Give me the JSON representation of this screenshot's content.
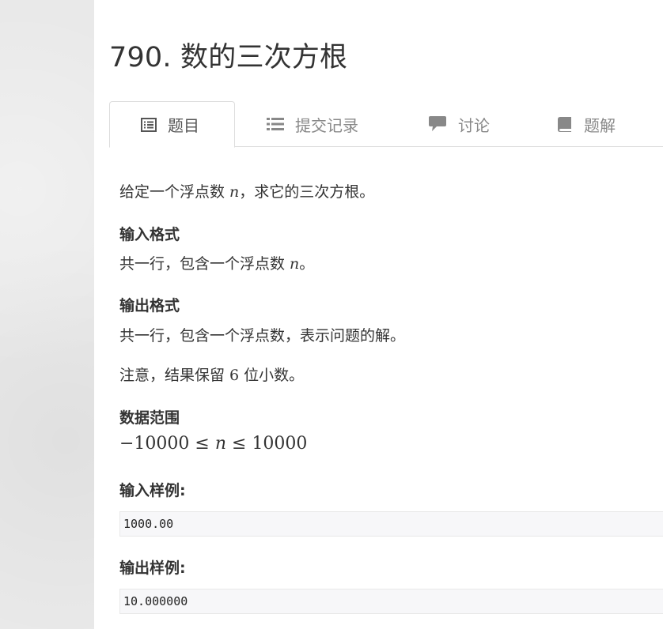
{
  "problem": {
    "title": "790. 数的三次方根"
  },
  "tabs": [
    {
      "label": "题目",
      "icon": "list-alt-icon",
      "active": true
    },
    {
      "label": "提交记录",
      "icon": "list-icon",
      "active": false
    },
    {
      "label": "讨论",
      "icon": "comment-icon",
      "active": false
    },
    {
      "label": "题解",
      "icon": "book-icon",
      "active": false
    }
  ],
  "description": {
    "text_before": "给定一个浮点数 ",
    "var": "n",
    "text_after": "，求它的三次方根。"
  },
  "input_format": {
    "heading": "输入格式",
    "text_before": "共一行，包含一个浮点数 ",
    "var": "n",
    "text_after": "。"
  },
  "output_format": {
    "heading": "输出格式",
    "text": "共一行，包含一个浮点数，表示问题的解。",
    "note_before": "注意，结果保留 ",
    "note_num": "6",
    "note_after": " 位小数。"
  },
  "data_range": {
    "heading": "数据范围",
    "low": "−10000",
    "le1": " ≤ ",
    "var": "n",
    "le2": " ≤ ",
    "high": "10000"
  },
  "sample_input": {
    "heading": "输入样例:",
    "code": "1000.00"
  },
  "sample_output": {
    "heading": "输出样例:",
    "code": "10.000000"
  }
}
